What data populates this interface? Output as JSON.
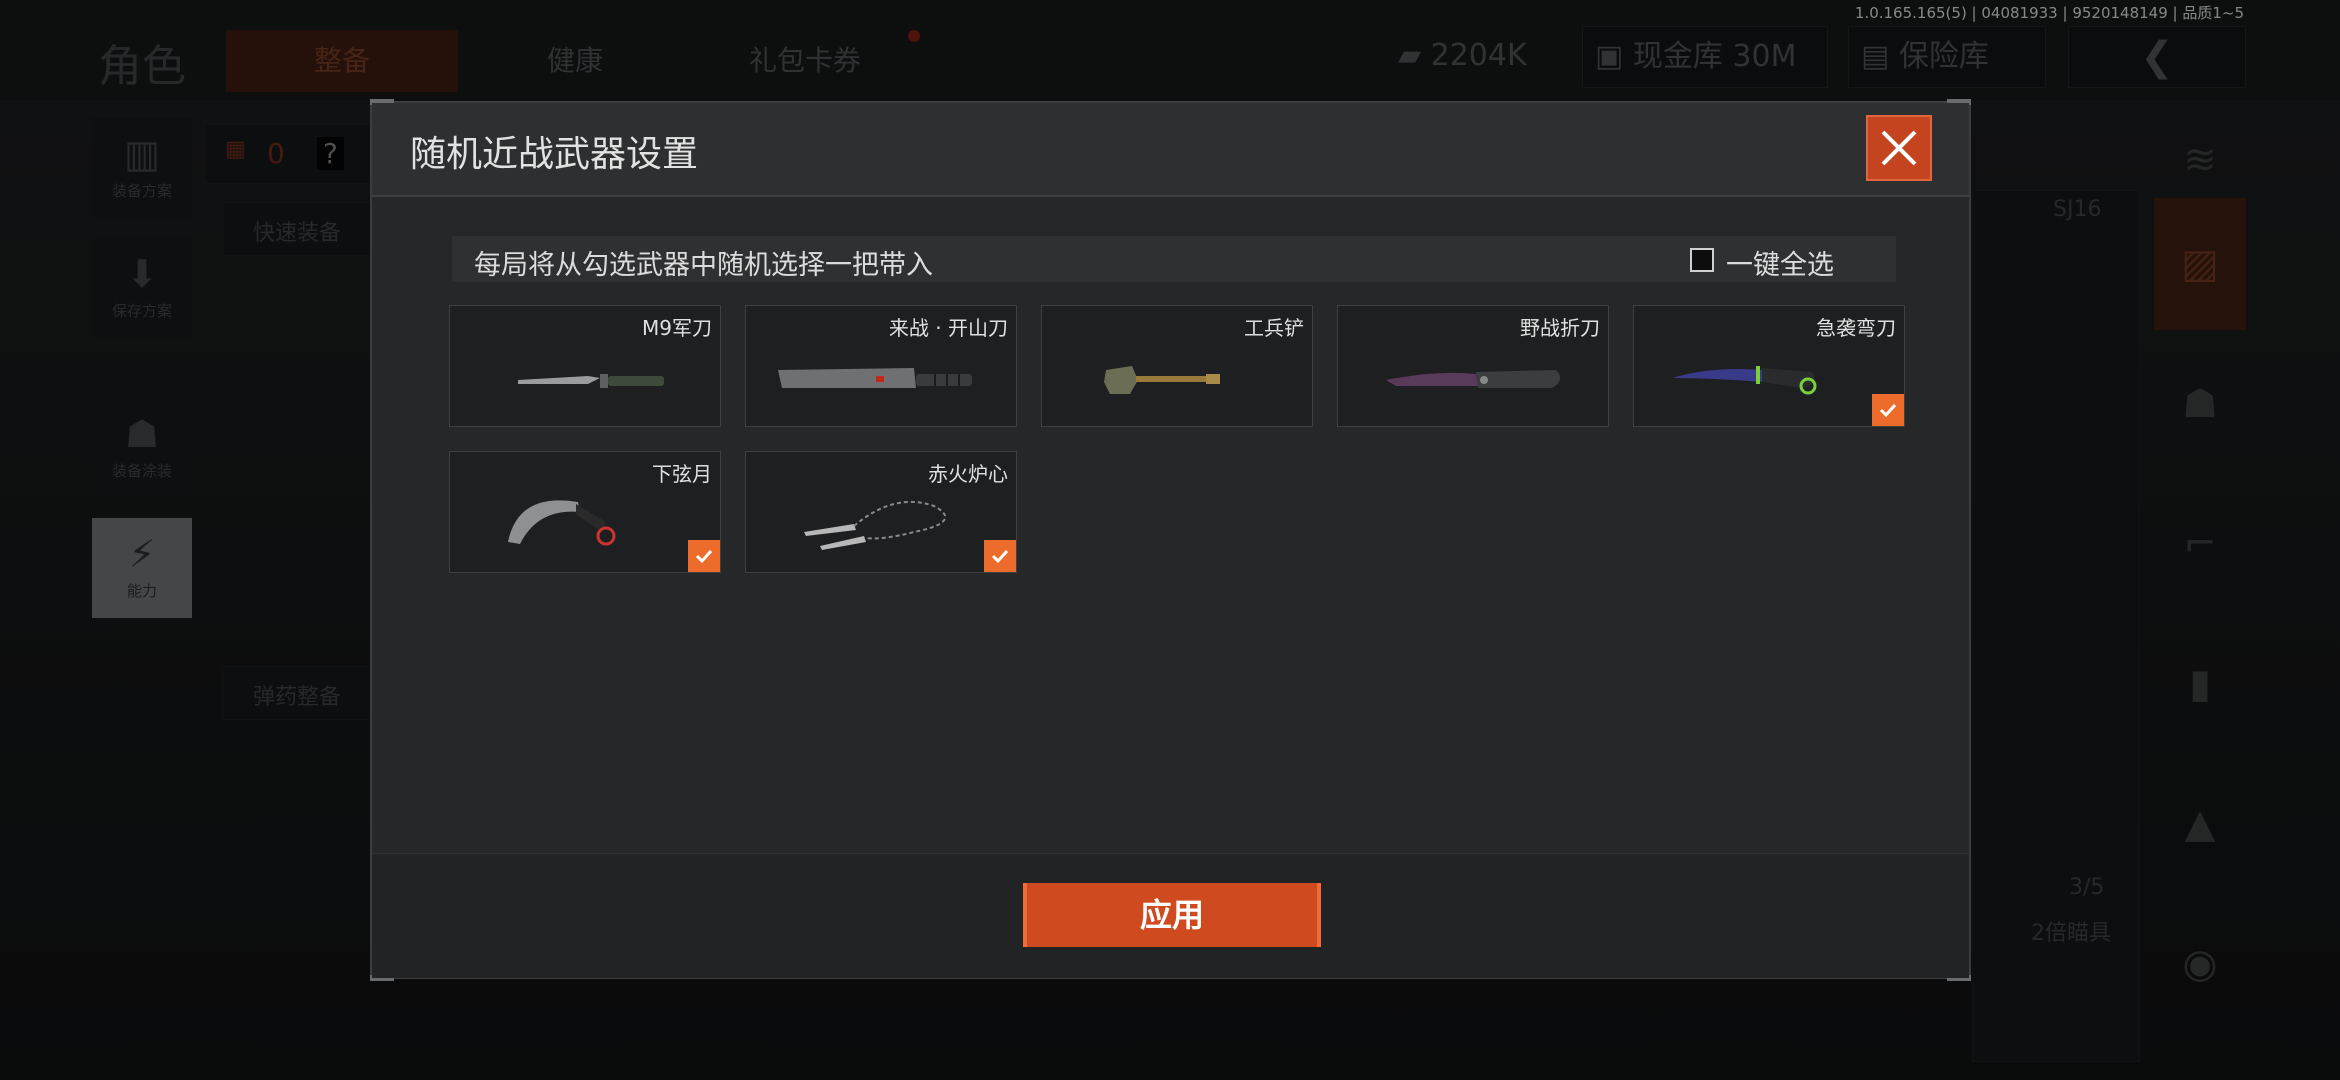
{
  "version": "1.0.165.165(5) | 04081933 | 9520148149 | 品质1~5",
  "background": {
    "title": "角色",
    "tabs": [
      "整备",
      "健康",
      "礼包卡券"
    ],
    "money": "2204K",
    "cash_vault": "现金库 30M",
    "safe_box": "保险库",
    "left_nav": [
      "装备方案",
      "保存方案",
      "装备涂装",
      "能力"
    ],
    "armor_count": "0",
    "help": "?",
    "quick_equip": "快速装备",
    "ammo_equip": "弹药整备",
    "weapon_label": "SJ16",
    "ammo_count": "3/5",
    "scope_label": "2倍瞄具"
  },
  "dialog": {
    "title": "随机近战武器设置",
    "instruction": "每局将从勾选武器中随机选择一把带入",
    "select_all": "一键全选",
    "apply": "应用",
    "weapons": [
      {
        "name": "M9军刀",
        "checked": false
      },
      {
        "name": "来战 · 开山刀",
        "checked": false
      },
      {
        "name": "工兵铲",
        "checked": false
      },
      {
        "name": "野战折刀",
        "checked": false
      },
      {
        "name": "急袭弯刀",
        "checked": true
      },
      {
        "name": "下弦月",
        "checked": true
      },
      {
        "name": "赤火炉心",
        "checked": true
      }
    ]
  },
  "colors": {
    "accent": "#ee6c2b",
    "close_bg": "#c4441f",
    "apply_bg": "#cf4a1f"
  }
}
